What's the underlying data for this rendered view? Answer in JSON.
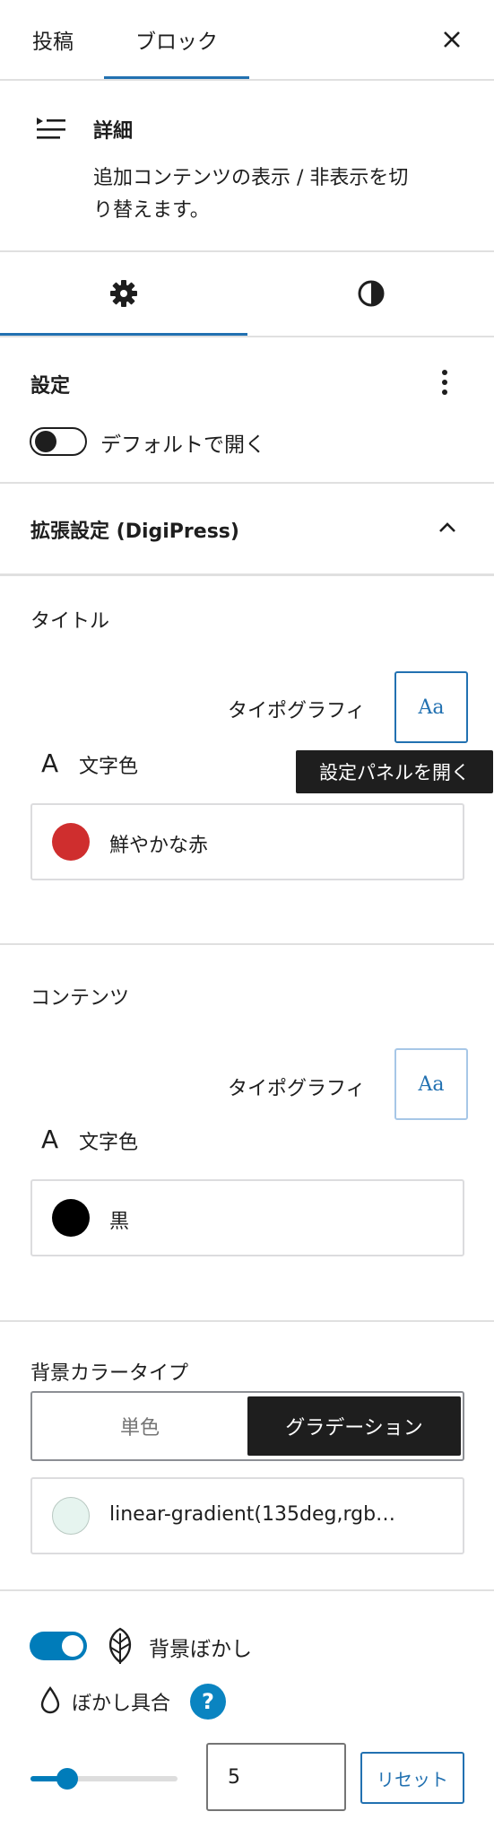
{
  "tabs": {
    "post": "投稿",
    "block": "ブロック"
  },
  "block": {
    "name": "詳細",
    "description_line1": "追加コンテンツの表示 / 非表示を切",
    "description_line2": "り替えます。"
  },
  "settings": {
    "heading": "設定",
    "open_default_label": "デフォルトで開く",
    "open_default_on": false
  },
  "extended": {
    "heading": "拡張設定 (DigiPress)"
  },
  "title_section": {
    "heading": "タイトル",
    "typography_label": "タイポグラフィ",
    "aa": "Aa",
    "tooltip": "設定パネルを開く",
    "text_color_label": "文字色",
    "text_color_icon": "A",
    "color_name": "鮮やかな赤",
    "color_hex": "#cf2e2e"
  },
  "content_section": {
    "heading": "コンテンツ",
    "typography_label": "タイポグラフィ",
    "aa": "Aa",
    "text_color_label": "文字色",
    "text_color_icon": "A",
    "color_name": "黒",
    "color_hex": "#000000"
  },
  "bg_section": {
    "heading": "背景カラータイプ",
    "options": [
      "単色",
      "グラデーション"
    ],
    "selected": "グラデーション",
    "gradient_value": "linear-gradient(135deg,rgb…",
    "swatch_color": "#e6f4ef"
  },
  "blur": {
    "label": "背景ぼかし",
    "enabled": true,
    "amount_label": "ぼかし具合",
    "help": "?",
    "value": "5",
    "slider_fraction": 0.25,
    "reset_label": "リセット"
  },
  "colors": {
    "accent": "#2271b1",
    "toggle_on": "#007cba",
    "help_badge": "#0a84c1"
  }
}
